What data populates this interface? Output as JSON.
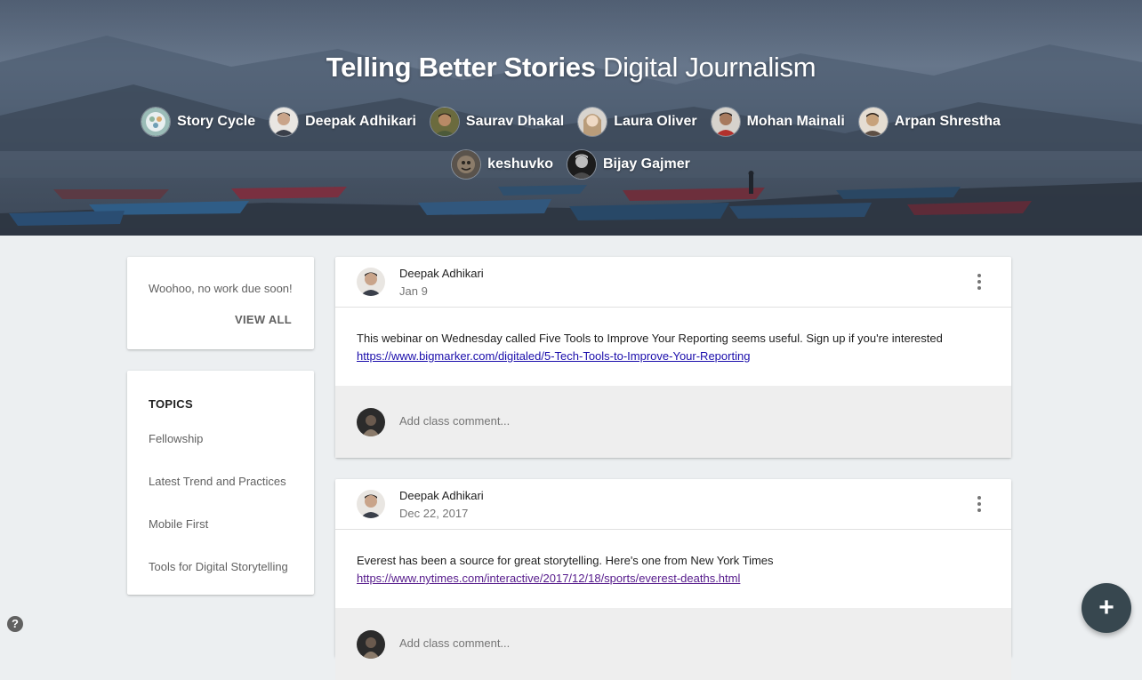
{
  "hero": {
    "title_bold": "Telling Better Stories",
    "title_light": "Digital Journalism",
    "teachers": [
      {
        "name": "Story Cycle",
        "avatar_icon": "story-cycle-logo-icon",
        "color": "#7fa7a2"
      },
      {
        "name": "Deepak Adhikari",
        "avatar_icon": "person-photo-icon",
        "color": "#c9a48a"
      },
      {
        "name": "Saurav Dhakal",
        "avatar_icon": "person-photo-icon",
        "color": "#8a7a4e"
      },
      {
        "name": "Laura Oliver",
        "avatar_icon": "person-photo-icon",
        "color": "#d9c3a5"
      },
      {
        "name": "Mohan Mainali",
        "avatar_icon": "person-photo-icon",
        "color": "#a84a3e"
      },
      {
        "name": "Arpan Shrestha",
        "avatar_icon": "person-photo-icon",
        "color": "#c7a27c"
      },
      {
        "name": "keshuvko",
        "avatar_icon": "person-photo-icon",
        "color": "#7a6a5a"
      },
      {
        "name": "Bijay Gajmer",
        "avatar_icon": "person-photo-icon",
        "color": "#3a3a3a"
      }
    ]
  },
  "upcoming": {
    "message": "Woohoo, no work due soon!",
    "view_all": "VIEW ALL"
  },
  "topics": {
    "heading": "TOPICS",
    "items": [
      "Fellowship",
      "Latest Trend and Practices",
      "Mobile First",
      "Tools for Digital Storytelling"
    ]
  },
  "posts": [
    {
      "author": "Deepak Adhikari",
      "date": "Jan 9",
      "text": "This webinar on Wednesday called Five Tools to Improve Your Reporting seems useful. Sign up if you're interested",
      "link": "https://www.bigmarker.com/digitaled/5-Tech-Tools-to-Improve-Your-Reporting",
      "comment_placeholder": "Add class comment..."
    },
    {
      "author": "Deepak Adhikari",
      "date": "Dec 22, 2017",
      "text": "Everest has been a source for great storytelling. Here's one from New York Times",
      "link": "https://www.nytimes.com/interactive/2017/12/18/sports/everest-deaths.html",
      "comment_placeholder": "Add class comment..."
    }
  ],
  "fab": {
    "label": "+",
    "icon": "plus-icon"
  },
  "help": {
    "label": "?",
    "icon": "help-icon"
  },
  "colors": {
    "fab": "#37474f",
    "background": "#eceff1",
    "link": "#1a0dab",
    "visited_link": "#551a8b"
  }
}
